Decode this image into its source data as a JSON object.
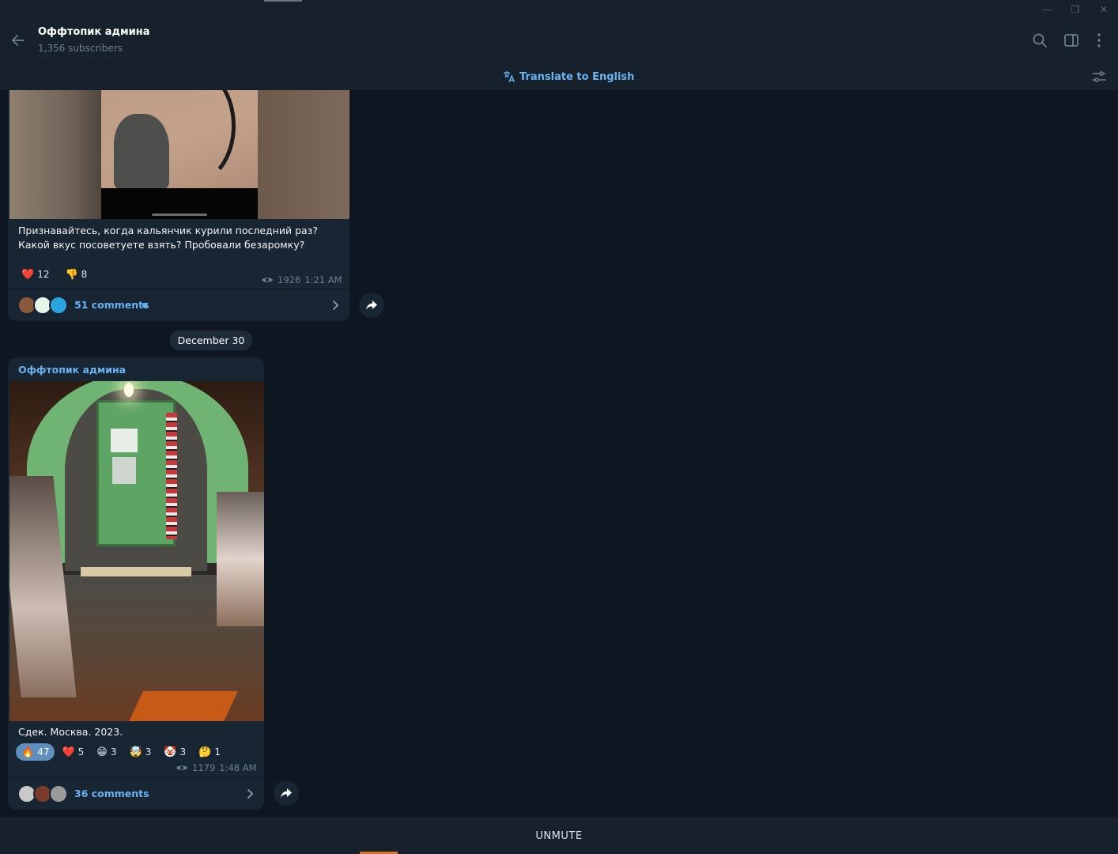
{
  "window": {
    "minimize_glyph": "—",
    "restore_glyph": "❐",
    "close_glyph": "✕"
  },
  "header": {
    "title": "Оффтопик админа",
    "subtitle": "1,356 subscribers",
    "icons": [
      "back-arrow-icon",
      "search-icon",
      "sidebar-toggle-icon",
      "more-vertical-icon"
    ]
  },
  "translate_bar": {
    "label": "Translate to English",
    "icons": [
      "translate-icon",
      "filter-settings-icon"
    ]
  },
  "messages": [
    {
      "caption": "Признавайтесь, когда кальянчик курили последний раз? Какой вкус посоветуете взять? Пробовали безаромку?",
      "reactions": [
        {
          "emoji": "❤️",
          "count": "12"
        },
        {
          "emoji": "👎",
          "count": "8"
        }
      ],
      "views": "1926",
      "time": "1:21 AM",
      "comments_label": "51 comments",
      "unread_dot": true
    },
    {
      "date_separator": "December 30",
      "author": "Оффтопик админа",
      "caption": "Сдек. Москва. 2023.",
      "reactions": [
        {
          "emoji": "🔥",
          "count": "47",
          "chosen": true
        },
        {
          "emoji": "❤️",
          "count": "5"
        },
        {
          "emoji": "😁",
          "count": "3"
        },
        {
          "emoji": "🤯",
          "count": "3"
        },
        {
          "emoji": "🤡",
          "count": "3"
        },
        {
          "emoji": "🤔",
          "count": "1"
        }
      ],
      "views": "1179",
      "time": "1:48 AM",
      "comments_label": "36 comments"
    }
  ],
  "bottom": {
    "unmute_label": "UNMUTE"
  },
  "colors": {
    "background": "#0e1621",
    "bubble": "#182533",
    "accent": "#6ab3f3",
    "header": "#17212b"
  }
}
